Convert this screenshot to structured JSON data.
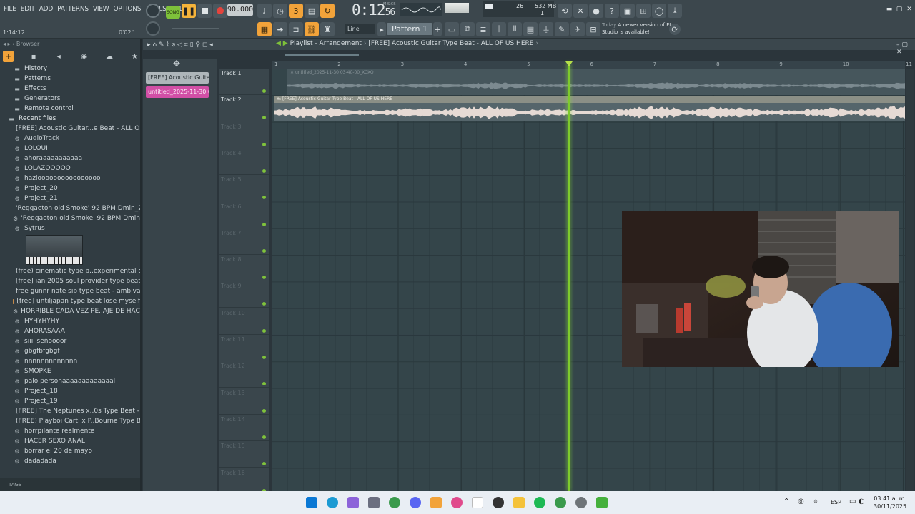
{
  "menu": [
    "FILE",
    "EDIT",
    "ADD",
    "PATTERNS",
    "VIEW",
    "OPTIONS",
    "TOOLS",
    "HELP"
  ],
  "hint": {
    "left": "1:14:12",
    "right": "0'02\""
  },
  "transport": {
    "mode_label": "SONG",
    "tempo": "90.000",
    "clock_main": "0:12",
    "clock_sub": "56",
    "clock_format": "M:S:CS"
  },
  "monitor": {
    "cpu": "26",
    "memory": "532 MB",
    "polyphony": "1"
  },
  "toolbar": {
    "snap": "Line",
    "pattern": "Pattern 1"
  },
  "news": {
    "when": "Today",
    "text": "A newer version of FL Studio is available!"
  },
  "browser": {
    "title": "Browser",
    "folders": [
      "History",
      "Patterns",
      "Effects",
      "Generators",
      "Remote control"
    ],
    "recent_title": "Recent files",
    "recent": [
      {
        "label": "[FREE] Acoustic Guitar...e Beat - ALL OF US HERE",
        "icon": "audio-file-icon"
      },
      {
        "label": "AudioTrack",
        "icon": "plugin-icon"
      },
      {
        "label": "LOLOUI",
        "icon": "plugin-icon"
      },
      {
        "label": "ahoraaaaaaaaaaa",
        "icon": "plugin-icon"
      },
      {
        "label": "LOLAZOOOOO",
        "icon": "plugin-icon"
      },
      {
        "label": "hazloooooooooooooooo",
        "icon": "plugin-icon"
      },
      {
        "label": "Project_20",
        "icon": "plugin-icon"
      },
      {
        "label": "Project_21",
        "icon": "plugin-icon"
      },
      {
        "label": "'Reggaeton old Smoke' 92 BPM Dmin_2",
        "icon": "audio-file-icon"
      },
      {
        "label": "'Reggaeton old Smoke' 92 BPM Dmin",
        "icon": "plugin-icon"
      },
      {
        "label": "Sytrus",
        "icon": "plugin-icon"
      }
    ],
    "recent_after": [
      {
        "label": "(free) cinematic type b..experimental  dramatic",
        "icon": "audio-file-icon"
      },
      {
        "label": "[free] ian  2005  soul provider type beat 3 am",
        "icon": "audio-file-icon"
      },
      {
        "label": "free gunnr  nate sib type beat - ambivalent",
        "icon": "audio-file-icon"
      },
      {
        "label": "[free] untiljapan type beat lose myself",
        "icon": "audio-file-icon"
      },
      {
        "label": "HORRIBLE CADA VEZ PE..AJE DE HACER MUSICA",
        "icon": "plugin-icon"
      },
      {
        "label": "HYHYHYHY",
        "icon": "plugin-icon"
      },
      {
        "label": "AHORASAAA",
        "icon": "plugin-icon"
      },
      {
        "label": "siiii señoooor",
        "icon": "plugin-icon"
      },
      {
        "label": "gbgfbfgbgf",
        "icon": "plugin-icon"
      },
      {
        "label": "nnnnnnnnnnnnn",
        "icon": "plugin-icon"
      },
      {
        "label": "SMOPKE",
        "icon": "plugin-icon"
      },
      {
        "label": "palo personaaaaaaaaaaaaal",
        "icon": "plugin-icon"
      },
      {
        "label": "Project_18",
        "icon": "plugin-icon"
      },
      {
        "label": "Project_19",
        "icon": "plugin-icon"
      },
      {
        "label": "[FREE] The Neptunes x..0s Type Beat - CALL ME",
        "icon": "audio-file-icon"
      },
      {
        "label": "(FREE) Playboi Carti x P..Bourne Type Beat Shift",
        "icon": "audio-file-icon"
      },
      {
        "label": "horrpilante realmente",
        "icon": "plugin-icon"
      },
      {
        "label": "HACER SEXO ANAL",
        "icon": "plugin-icon"
      },
      {
        "label": "borrar el 20 de mayo",
        "icon": "plugin-icon"
      },
      {
        "label": "dadadada",
        "icon": "plugin-icon"
      }
    ],
    "tags_label": "TAGS"
  },
  "playlist": {
    "title": "Playlist - Arrangement",
    "project": "[FREE] Acoustic Guitar Type Beat - ALL OF US HERE",
    "clip_list": [
      "[FREE] Acoustic Guita...",
      "untitled_2025-11-30 03-..."
    ],
    "tracks": [
      "Track 1",
      "Track 2",
      "Track 3",
      "Track 4",
      "Track 5",
      "Track 6",
      "Track 7",
      "Track 8",
      "Track 9",
      "Track 10",
      "Track 11",
      "Track 12",
      "Track 13",
      "Track 14",
      "Track 15",
      "Track 16"
    ],
    "bars": [
      "1",
      "2",
      "3",
      "4",
      "5",
      "6",
      "7",
      "8",
      "9",
      "10",
      "11"
    ],
    "clips": [
      {
        "name": "untitled_2025-11-30 03-40-00_XOXO",
        "track": 1
      },
      {
        "name": "[FREE] Acoustic Guitar Type Beat - ALL OF US HERE",
        "track": 2
      }
    ]
  },
  "taskbar": {
    "language": "ESP",
    "time": "03:41 a. m.",
    "date": "30/11/2025"
  },
  "colors": {
    "accent": "#f2a33a",
    "song": "#7ec13a",
    "playhead": "#7ecb2c",
    "pattern_clip": "#d24fa6"
  }
}
